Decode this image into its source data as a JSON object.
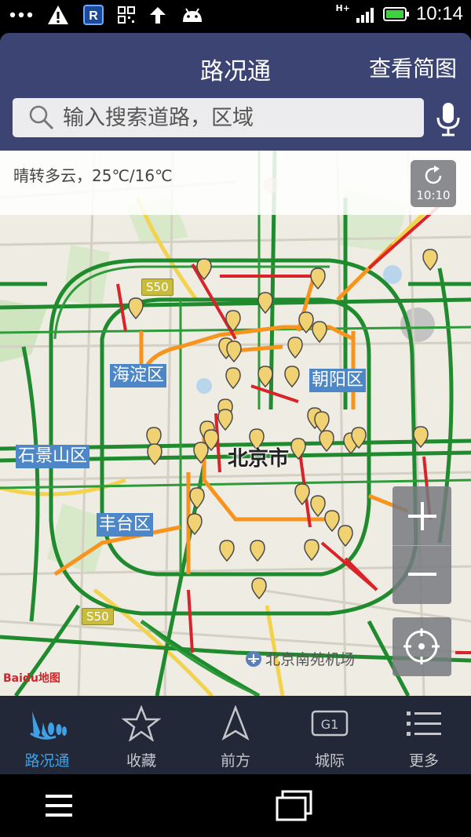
{
  "status_bar": {
    "time": "10:14",
    "network": "H+",
    "left_icons": [
      "more-icon",
      "warning-icon",
      "r-app-icon",
      "qr-icon",
      "upload-icon",
      "android-icon"
    ]
  },
  "header": {
    "title": "路况通",
    "simple_map_label": "查看简图"
  },
  "search": {
    "placeholder": "输入搜索道路，区域"
  },
  "map": {
    "weather": "晴转多云，25℃/16℃",
    "refresh_time": "10:10",
    "city_label": "北京市",
    "districts": [
      "海淀区",
      "朝阳区",
      "石景山区",
      "丰台区"
    ],
    "road_badges": [
      "S50",
      "S50"
    ],
    "airport": "北京南苑机场",
    "logo": "Baidu地图"
  },
  "tabs": [
    {
      "label": "路况通",
      "icon": "traffic-icon",
      "active": true
    },
    {
      "label": "收藏",
      "icon": "star-icon",
      "active": false
    },
    {
      "label": "前方",
      "icon": "navigation-arrow-icon",
      "active": false
    },
    {
      "label": "城际",
      "icon": "g1-highway-icon",
      "active": false
    },
    {
      "label": "更多",
      "icon": "list-icon",
      "active": false
    }
  ],
  "colors": {
    "header": "#3b4472",
    "tabbar": "#232838",
    "active_tab": "#3fa0e6",
    "jam": "#d8232a",
    "slow": "#f7941d",
    "clear": "#1f8a2e"
  }
}
